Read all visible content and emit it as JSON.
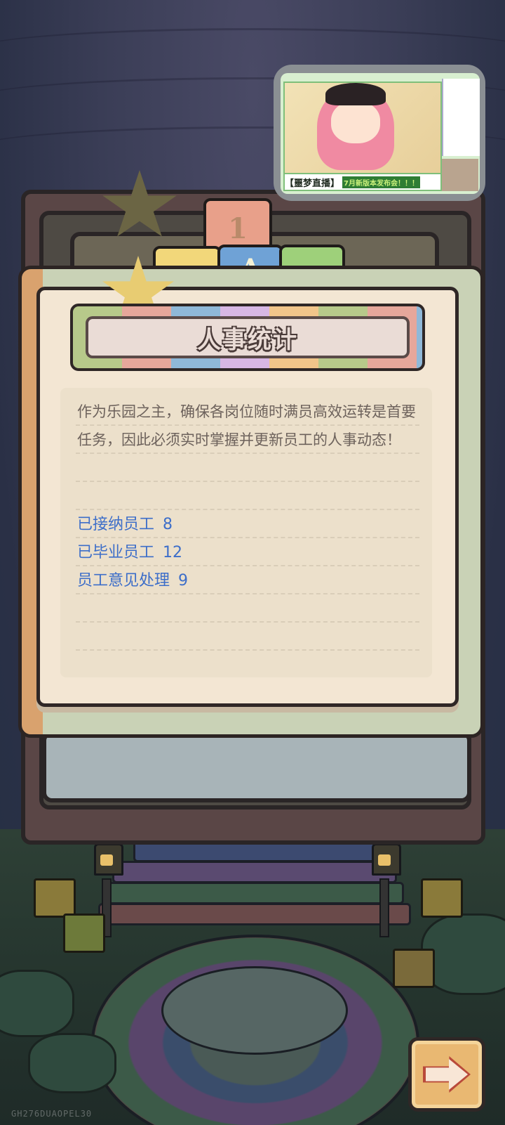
{
  "dialog": {
    "title": "人事统计",
    "description": "作为乐园之主，确保各岗位随时满员高效运转是首要任务，因此必须实时掌握并更新员工的人事动态！",
    "stats": [
      {
        "label": "已接纳员工",
        "value": "8"
      },
      {
        "label": "已毕业员工",
        "value": "12"
      },
      {
        "label": "员工意见处理",
        "value": "9"
      }
    ]
  },
  "toy_blocks": {
    "number_block": "1",
    "letter_block": "A"
  },
  "stream_overlay": {
    "caption_left": "【噩梦",
    "caption_right": "直播】",
    "caption_highlight": "7月新版本发布会！！！"
  },
  "buttons": {
    "next_icon": "arrow-right-icon"
  },
  "footer": {
    "watermark": "GH276DUAOPEL30"
  },
  "colors": {
    "stat_text": "#3d6ec9",
    "body_text": "#6d625c",
    "card_bg": "#f3e6d3"
  }
}
